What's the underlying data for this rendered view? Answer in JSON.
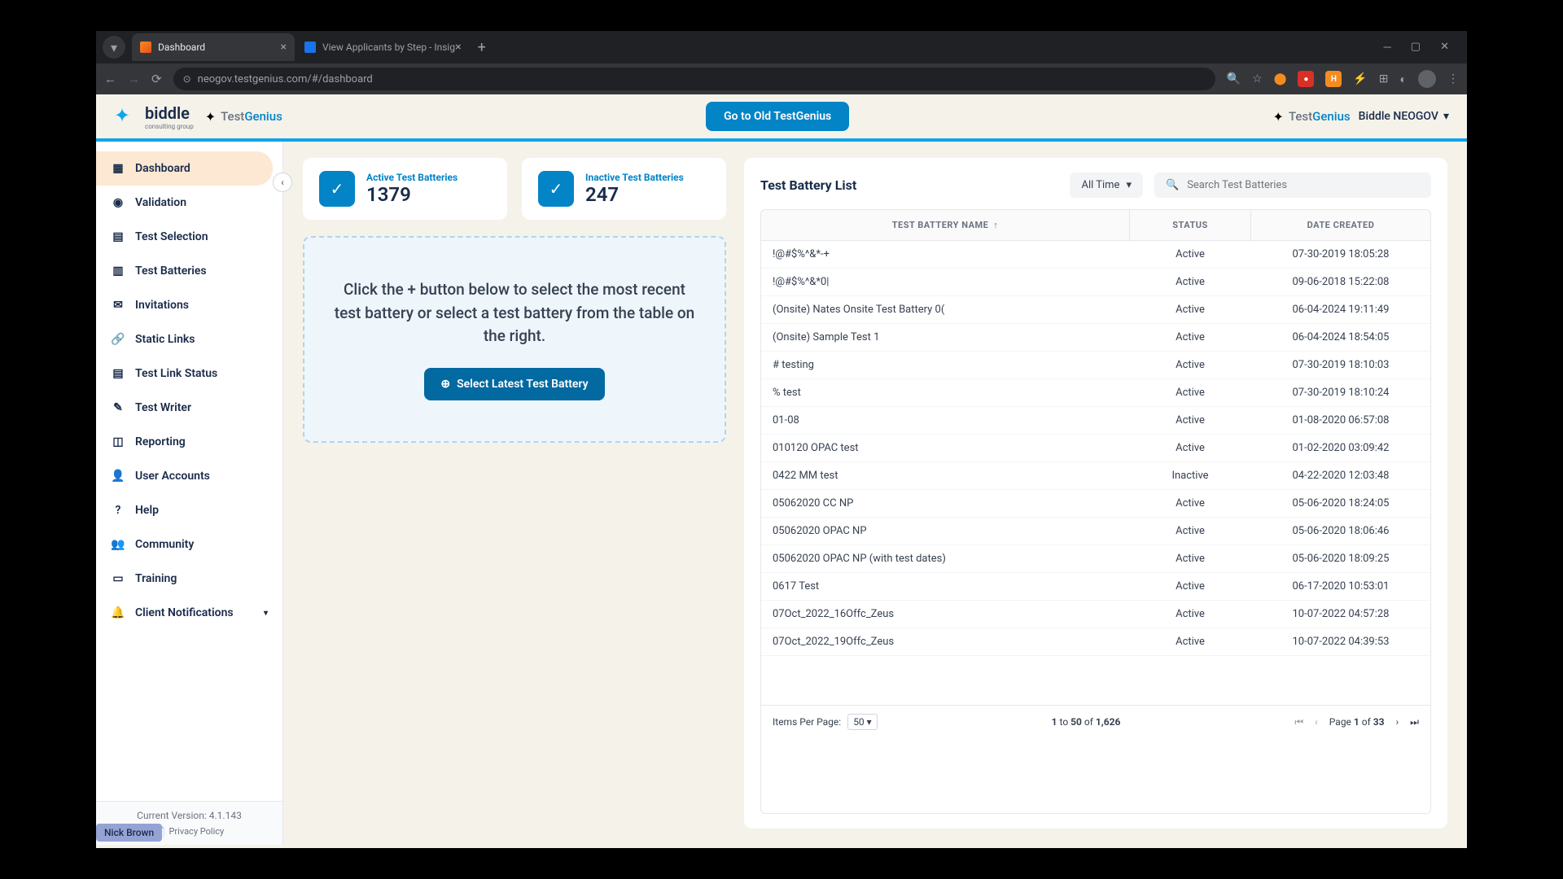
{
  "browser": {
    "tabs": [
      {
        "title": "Dashboard",
        "active": true
      },
      {
        "title": "View Applicants by Step - Insig",
        "active": false
      }
    ],
    "url": "neogov.testgenius.com/#/dashboard"
  },
  "brand": {
    "biddle": "biddle",
    "biddle_sub": "consulting group",
    "tg_grey": "Test",
    "tg_blue": "Genius",
    "old_btn": "Go to Old TestGenius",
    "user_org": "Biddle NEOGOV"
  },
  "sidebar": {
    "items": [
      {
        "label": "Dashboard",
        "icon": "grid"
      },
      {
        "label": "Validation",
        "icon": "check-circle"
      },
      {
        "label": "Test Selection",
        "icon": "clipboard"
      },
      {
        "label": "Test Batteries",
        "icon": "layers"
      },
      {
        "label": "Invitations",
        "icon": "mail"
      },
      {
        "label": "Static Links",
        "icon": "link"
      },
      {
        "label": "Test Link Status",
        "icon": "list"
      },
      {
        "label": "Test Writer",
        "icon": "pen"
      },
      {
        "label": "Reporting",
        "icon": "chart"
      },
      {
        "label": "User Accounts",
        "icon": "user"
      },
      {
        "label": "Help",
        "icon": "help"
      },
      {
        "label": "Community",
        "icon": "users"
      },
      {
        "label": "Training",
        "icon": "monitor"
      },
      {
        "label": "Client Notifications",
        "icon": "bell"
      }
    ],
    "version_label": "Current Version: 4.1.143",
    "privacy": "Privacy Policy"
  },
  "stats": {
    "active_label": "Active Test Batteries",
    "active_value": "1379",
    "inactive_label": "Inactive Test Batteries",
    "inactive_value": "247"
  },
  "guide": {
    "text": "Click the + button below to select the most recent test battery or select a test battery from the table on the right.",
    "button": "Select Latest Test Battery"
  },
  "list": {
    "title": "Test Battery List",
    "filter": "All Time",
    "search_placeholder": "Search Test Batteries",
    "col_name": "TEST BATTERY NAME",
    "col_status": "STATUS",
    "col_date": "DATE CREATED",
    "rows": [
      {
        "name": "!@#$%^&*-+",
        "status": "Active",
        "date": "07-30-2019 18:05:28"
      },
      {
        "name": "!@#$%^&*0|",
        "status": "Active",
        "date": "09-06-2018 15:22:08"
      },
      {
        "name": "(Onsite) Nates Onsite Test Battery 0(",
        "status": "Active",
        "date": "06-04-2024 19:11:49"
      },
      {
        "name": "(Onsite) Sample Test 1",
        "status": "Active",
        "date": "06-04-2024 18:54:05"
      },
      {
        "name": "# testing",
        "status": "Active",
        "date": "07-30-2019 18:10:03"
      },
      {
        "name": "% test",
        "status": "Active",
        "date": "07-30-2019 18:10:24"
      },
      {
        "name": "01-08",
        "status": "Active",
        "date": "01-08-2020 06:57:08"
      },
      {
        "name": "010120 OPAC test",
        "status": "Active",
        "date": "01-02-2020 03:09:42"
      },
      {
        "name": "0422 MM test",
        "status": "Inactive",
        "date": "04-22-2020 12:03:48"
      },
      {
        "name": "05062020 CC NP",
        "status": "Active",
        "date": "05-06-2020 18:24:05"
      },
      {
        "name": "05062020 OPAC NP",
        "status": "Active",
        "date": "05-06-2020 18:06:46"
      },
      {
        "name": "05062020 OPAC NP (with test dates)",
        "status": "Active",
        "date": "05-06-2020 18:09:25"
      },
      {
        "name": "0617 Test",
        "status": "Active",
        "date": "06-17-2020 10:53:01"
      },
      {
        "name": "07Oct_2022_16Offc_Zeus",
        "status": "Active",
        "date": "10-07-2022 04:57:28"
      },
      {
        "name": "07Oct_2022_19Offc_Zeus",
        "status": "Active",
        "date": "10-07-2022 04:39:53"
      }
    ],
    "items_per_page_label": "Items Per Page:",
    "items_per_page_value": "50",
    "range_from": "1",
    "range_to": "50",
    "range_of": "of",
    "range_total": "1,626",
    "page_label": "Page",
    "page_current": "1",
    "page_of": "of",
    "page_total": "33"
  },
  "host_name": "Nick Brown"
}
